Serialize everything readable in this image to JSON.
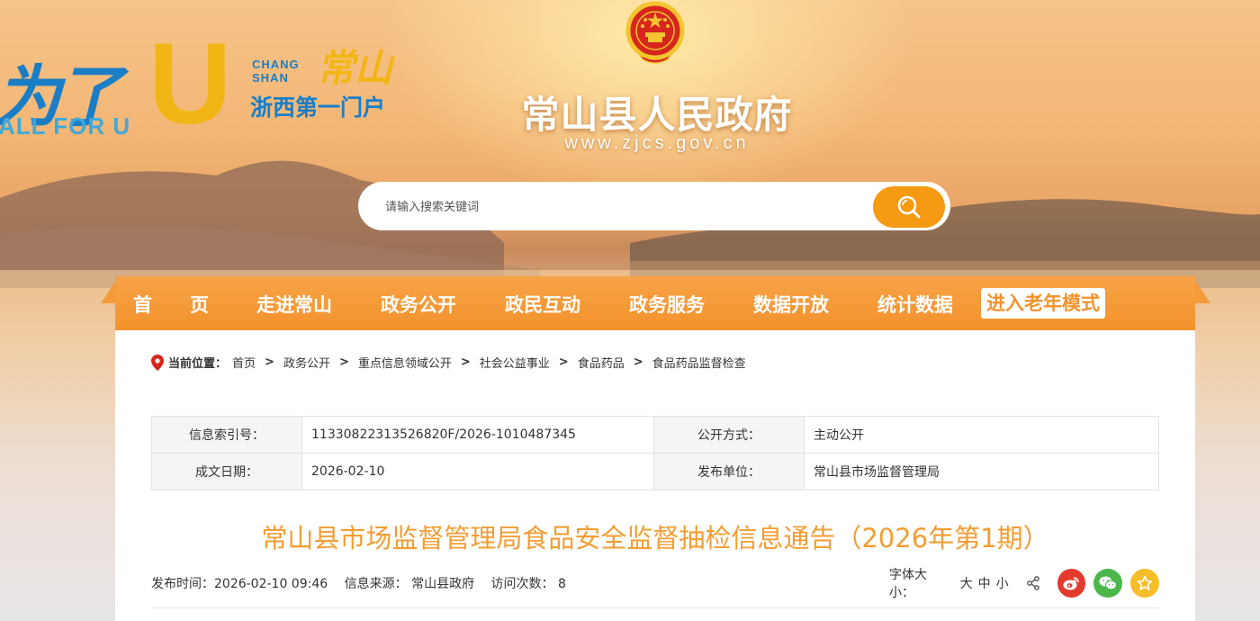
{
  "header": {
    "slogan_cn": "为了",
    "slogan_u": "U",
    "slogan_en": "ALL FOR U",
    "changshan_en_line1": "CHANG",
    "changshan_en_line2": "SHAN",
    "changshan_calligraphy": "常山",
    "portal_text": "浙西第一门户",
    "site_title": "常山县人民政府",
    "site_url": "www.zjcs.gov.cn",
    "emblem_icon": "national-emblem-icon"
  },
  "search": {
    "placeholder": "请输入搜索关键词",
    "value": "",
    "button_icon": "search-icon"
  },
  "nav": {
    "items": [
      {
        "label": "首　　页"
      },
      {
        "label": "走进常山"
      },
      {
        "label": "政务公开"
      },
      {
        "label": "政民互动"
      },
      {
        "label": "政务服务"
      },
      {
        "label": "数据开放"
      },
      {
        "label": "统计数据"
      }
    ],
    "elder_mode": "进入老年模式"
  },
  "breadcrumb": {
    "lead": "当前位置：",
    "items": [
      "首页",
      "政务公开",
      "重点信息领域公开",
      "社会公益事业",
      "食品药品",
      "食品药品监督检查"
    ],
    "separator": ">"
  },
  "meta": {
    "index_label": "信息索引号：",
    "index_value": "11330822313526820F/2026-1010487345",
    "disclosure_label": "公开方式：",
    "disclosure_value": "主动公开",
    "date_label": "成文日期：",
    "date_value": "2026-02-10",
    "publisher_label": "发布单位：",
    "publisher_value": "常山县市场监督管理局"
  },
  "article": {
    "title": "常山县市场监督管理局食品安全监督抽检信息通告（2026年第1期）",
    "publish_time": "发布时间：2026-02-10 09:46",
    "source": "信息来源： 常山县政府",
    "visits": "访问次数： 8"
  },
  "tools": {
    "font_size_label": "字体大小：",
    "font_large": "大",
    "font_medium": "中",
    "font_small": "小"
  },
  "colors": {
    "accent_orange": "#f3922c",
    "title_orange": "#f39d33",
    "weibo_red": "#e23b2e",
    "wechat_green": "#4ab849",
    "fav_yellow": "#f5bd28"
  }
}
